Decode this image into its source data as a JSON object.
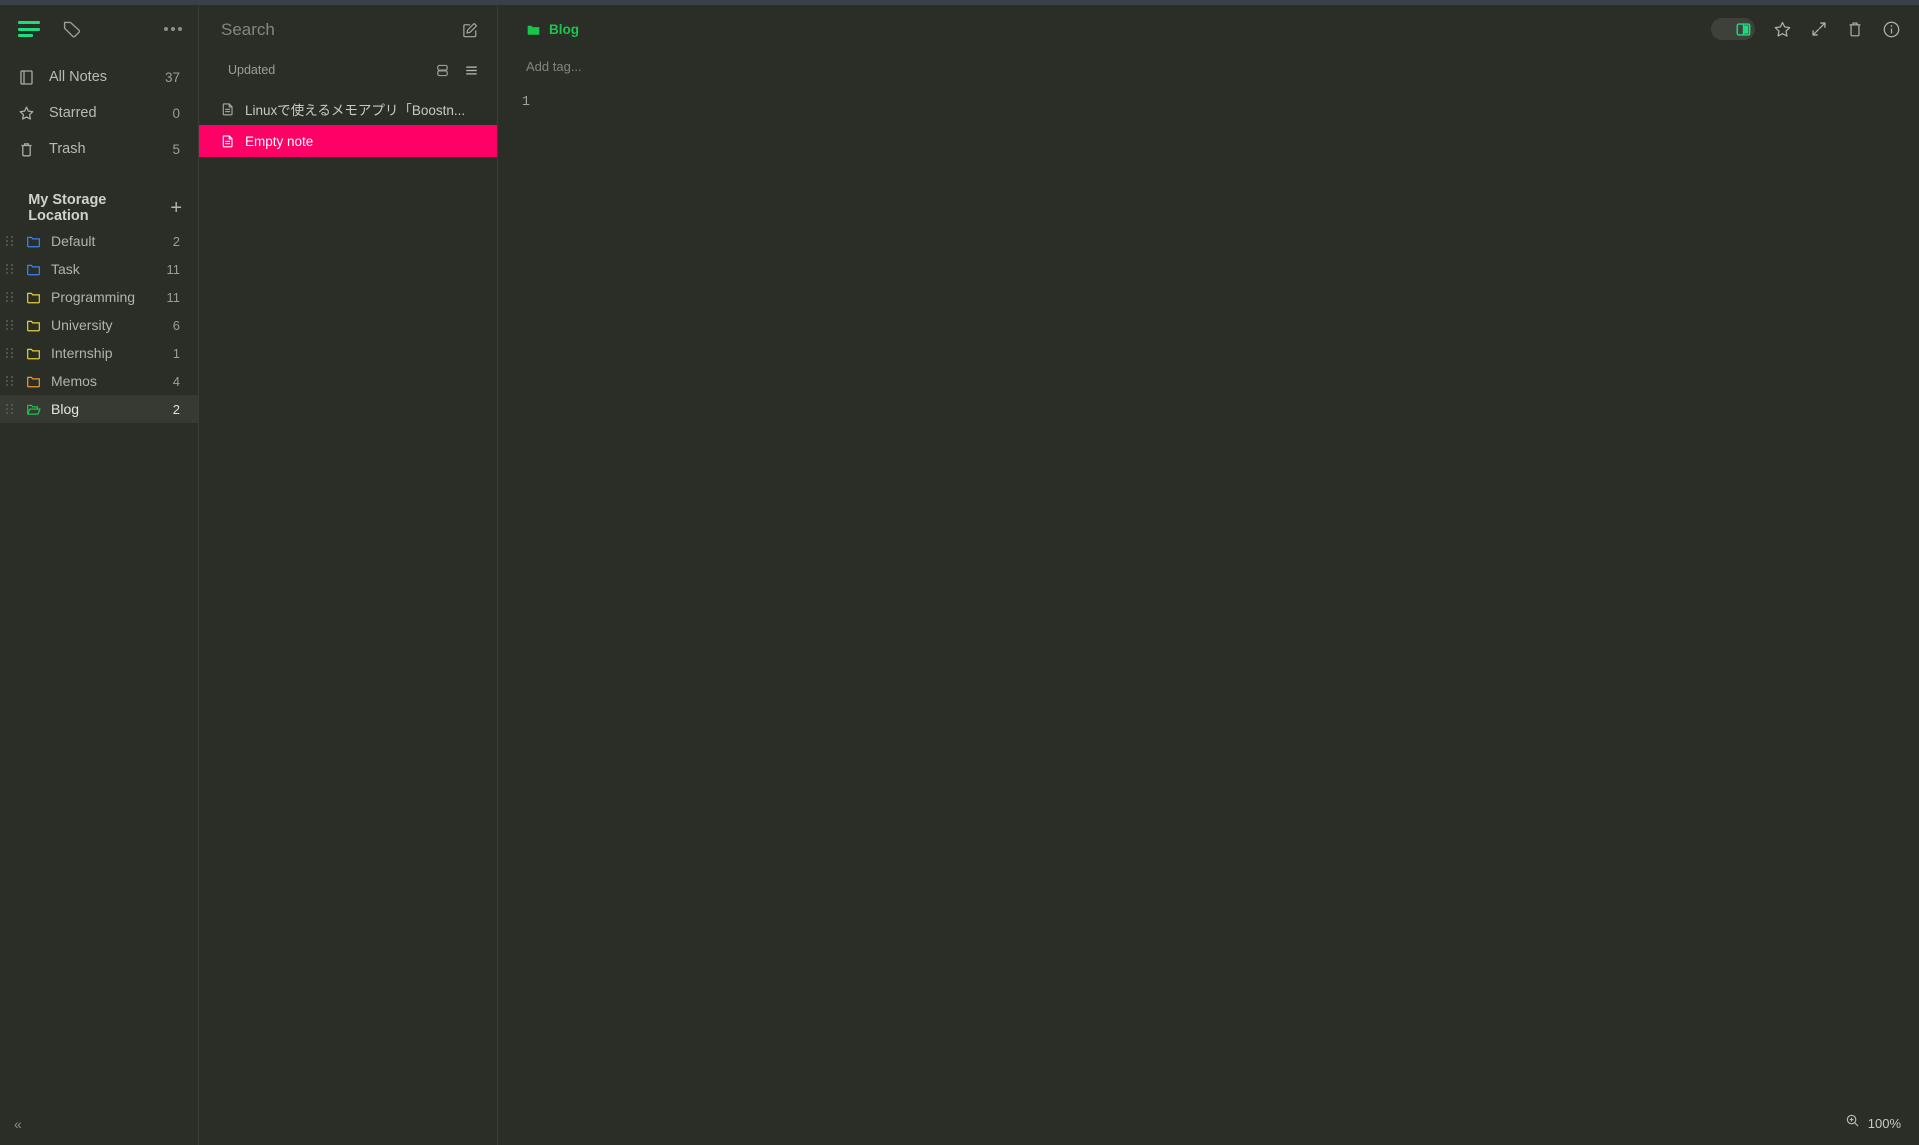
{
  "theme": {
    "bg": "#2b2e27",
    "panel_border": "#3a3d35",
    "titlebar": "#3c4149",
    "accent_green": "#1ddb7f",
    "breadcrumb_green": "#17c64a",
    "selection_pink": "#ff0066",
    "selected_row": "#373a33",
    "text": "#b7bbb2",
    "muted": "#9a9e94"
  },
  "sidebar": {
    "top_icons": [
      {
        "name": "hamburger-icon",
        "label": "Notes view",
        "active": true
      },
      {
        "name": "tag-icon",
        "label": "Tags view",
        "active": false
      },
      {
        "name": "more-options-icon",
        "label": "More options"
      }
    ],
    "nav": [
      {
        "icon": "book-icon",
        "label": "All Notes",
        "count": "37"
      },
      {
        "icon": "star-icon",
        "label": "Starred",
        "count": "0"
      },
      {
        "icon": "trash-icon",
        "label": "Trash",
        "count": "5"
      }
    ],
    "storage": {
      "chevron": "ⱟ",
      "title": "My Storage Location",
      "add_label": "+"
    },
    "folders": [
      {
        "label": "Default",
        "count": "2",
        "color": "#3b82f6",
        "open": false,
        "selected": false
      },
      {
        "label": "Task",
        "count": "11",
        "color": "#3b82f6",
        "open": false,
        "selected": false
      },
      {
        "label": "Programming",
        "count": "11",
        "color": "#e6cf3a",
        "open": false,
        "selected": false
      },
      {
        "label": "University",
        "count": "6",
        "color": "#e6cf3a",
        "open": false,
        "selected": false
      },
      {
        "label": "Internship",
        "count": "1",
        "color": "#e6cf3a",
        "open": false,
        "selected": false
      },
      {
        "label": "Memos",
        "count": "4",
        "color": "#f09a2b",
        "open": false,
        "selected": false
      },
      {
        "label": "Blog",
        "count": "2",
        "color": "#17c64a",
        "open": true,
        "selected": true
      }
    ],
    "collapse_label": "«"
  },
  "notelist": {
    "search": {
      "placeholder": "Search",
      "value": ""
    },
    "compose_icon": "compose-note-icon",
    "sort": {
      "chevron": "ⱟ",
      "label": "Updated"
    },
    "view_modes": [
      {
        "name": "split-view-icon",
        "label": "Split list view"
      },
      {
        "name": "compact-list-icon",
        "label": "Compact list view"
      }
    ],
    "notes": [
      {
        "title": "Linuxで使えるメモアプリ「Boostn...",
        "icon": "note-doc-icon",
        "active": false
      },
      {
        "title": "Empty note",
        "icon": "note-doc-icon",
        "active": true
      }
    ]
  },
  "editor": {
    "breadcrumb": {
      "icon": "folder-filled-icon",
      "label": "Blog"
    },
    "tag_input": {
      "placeholder": "Add tag...",
      "value": ""
    },
    "toolbar": [
      {
        "name": "split-pane-toggle",
        "label": "Toggle split pane",
        "state": "on"
      },
      {
        "name": "star-icon",
        "label": "Star note"
      },
      {
        "name": "expand-icon",
        "label": "Focus mode"
      },
      {
        "name": "trash-icon",
        "label": "Delete note"
      },
      {
        "name": "info-icon",
        "label": "Note info"
      }
    ],
    "line_numbers": [
      "1"
    ],
    "content_lines": [
      ""
    ],
    "zoom": {
      "icon": "zoom-in-icon",
      "level": "100%"
    }
  }
}
